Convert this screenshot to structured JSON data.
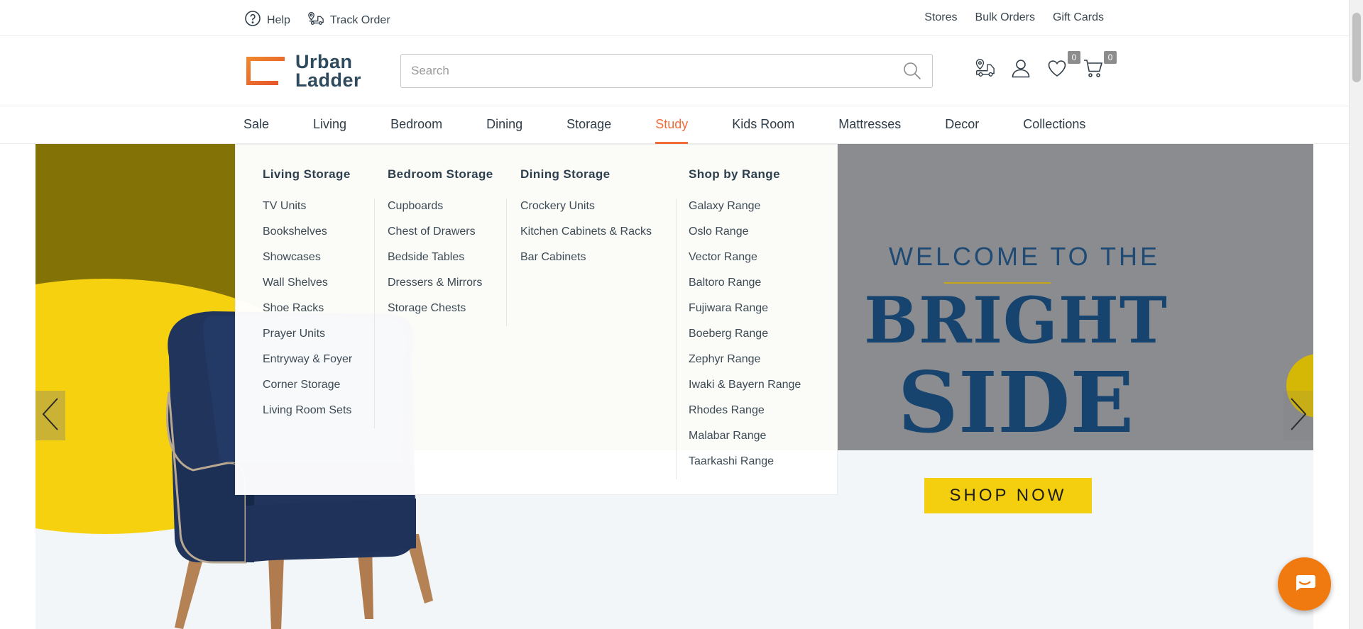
{
  "utility_bar": {
    "help_label": "Help",
    "track_order_label": "Track Order",
    "right_links": [
      "Stores",
      "Bulk Orders",
      "Gift Cards"
    ]
  },
  "header": {
    "logo_line1": "Urban",
    "logo_line2": "Ladder",
    "search_placeholder": "Search",
    "search_value": "",
    "wishlist_count": "0",
    "cart_count": "0",
    "icons": [
      "store-locator-icon",
      "account-icon",
      "wishlist-icon",
      "cart-icon"
    ]
  },
  "nav": {
    "items": [
      "Sale",
      "Living",
      "Bedroom",
      "Dining",
      "Storage",
      "Study",
      "Kids Room",
      "Mattresses",
      "Decor",
      "Collections"
    ],
    "active": "Study"
  },
  "mega_menu": {
    "columns": [
      {
        "heading": "Living Storage",
        "items": [
          "TV Units",
          "Bookshelves",
          "Showcases",
          "Wall Shelves",
          "Shoe Racks",
          "Prayer Units",
          "Entryway & Foyer",
          "Corner Storage",
          "Living Room Sets"
        ]
      },
      {
        "heading": "Bedroom Storage",
        "items": [
          "Cupboards",
          "Chest of Drawers",
          "Bedside Tables",
          "Dressers & Mirrors",
          "Storage Chests"
        ]
      },
      {
        "heading": "Dining Storage",
        "items": [
          "Crockery Units",
          "Kitchen Cabinets & Racks",
          "Bar Cabinets"
        ]
      },
      {
        "heading": "Shop by Range",
        "items": [
          "Galaxy Range",
          "Oslo Range",
          "Vector Range",
          "Baltoro Range",
          "Fujiwara Range",
          "Boeberg Range",
          "Zephyr Range",
          "Iwaki & Bayern Range",
          "Rhodes Range",
          "Malabar Range",
          "Taarkashi Range"
        ]
      }
    ]
  },
  "hero": {
    "welcome": "WELCOME TO THE",
    "bright": "BRIGHT",
    "side": "SIDE",
    "cta": "SHOP NOW"
  },
  "colors": {
    "accent": "#f26c38",
    "hero_olive": "#837205",
    "hero_grey": "#8b8c90",
    "hero_yellow": "#f3cf10",
    "hero_navy": "#16446f",
    "chat": "#f07a10"
  }
}
